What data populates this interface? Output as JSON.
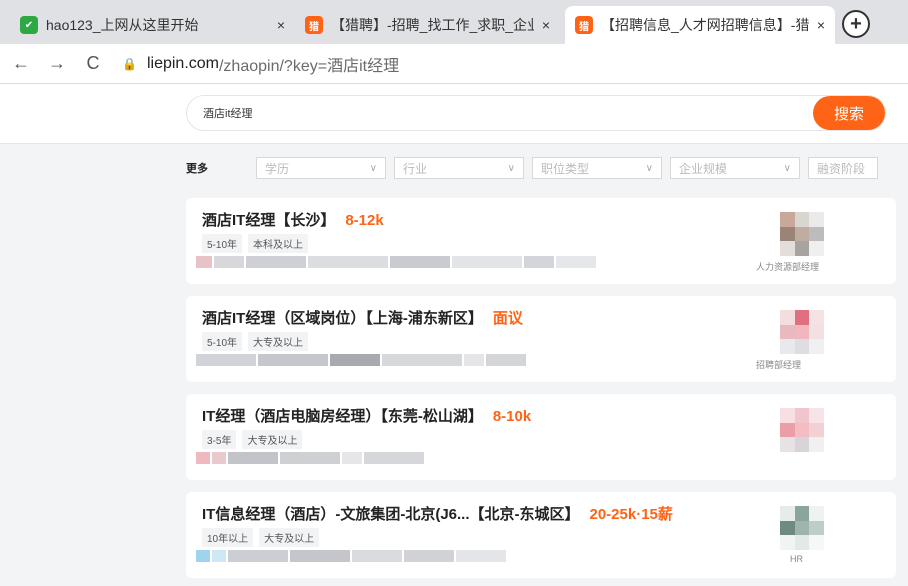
{
  "browser": {
    "tabs": [
      {
        "title": "hao123_上网从这里开始",
        "favicon": "hao123-icon",
        "active": false
      },
      {
        "title": "【猎聘】-招聘_找工作_求职_企业",
        "favicon": "liepin-icon",
        "active": false
      },
      {
        "title": "【招聘信息_人才网招聘信息】-猎",
        "favicon": "liepin-icon",
        "active": true
      }
    ],
    "url_host": "liepin.com",
    "url_path": "/zhaopin/?key=酒店it经理",
    "back": "←",
    "forward": "→",
    "reload": "C",
    "lock": "🔒",
    "newtab": "+",
    "close": "×"
  },
  "search": {
    "query": "酒店it经理",
    "button_label": "搜索"
  },
  "filters": {
    "more": "更多",
    "items": [
      "学历",
      "行业",
      "职位类型",
      "企业规模",
      "融资阶段"
    ]
  },
  "jobs": [
    {
      "title": "酒店IT经理【长沙】",
      "salary": "8-12k",
      "tags": [
        "5-10年",
        "本科及以上"
      ],
      "recruiter": "人力资源部经理"
    },
    {
      "title": "酒店IT经理（区域岗位）【上海-浦东新区】",
      "salary": "面议",
      "tags": [
        "5-10年",
        "大专及以上"
      ],
      "recruiter": "招聘部经理"
    },
    {
      "title": "IT经理（酒店电脑房经理）【东莞-松山湖】",
      "salary": "8-10k",
      "tags": [
        "3-5年",
        "大专及以上"
      ],
      "recruiter": ""
    },
    {
      "title": "IT信息经理（酒店）-文旅集团-北京(J6...【北京-东城区】",
      "salary": "20-25k·15薪",
      "tags": [
        "10年以上",
        "大专及以上"
      ],
      "recruiter": "HR"
    }
  ],
  "colors": {
    "accent": "#ff6315",
    "tab_bg": "#dfe1e5",
    "page_bg": "#f3f4f6"
  }
}
